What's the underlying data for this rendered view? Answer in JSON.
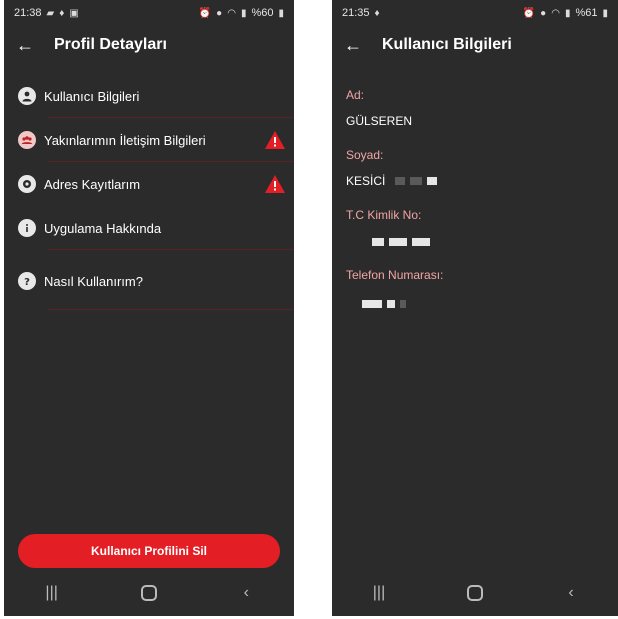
{
  "left_phone": {
    "status_time": "21:38",
    "status_battery": "%60",
    "title": "Profil Detayları",
    "menu": [
      {
        "label": "Kullanıcı Bilgileri",
        "icon": "person-icon",
        "warning": false
      },
      {
        "label": "Yakınlarımın İletişim Bilgileri",
        "icon": "group-icon",
        "warning": true
      },
      {
        "label": "Adres Kayıtlarım",
        "icon": "location-icon",
        "warning": true
      },
      {
        "label": "Uygulama Hakkında",
        "icon": "info-icon",
        "warning": false
      },
      {
        "label": "Nasıl Kullanırım?",
        "icon": "help-icon",
        "warning": false
      }
    ],
    "delete_button": "Kullanıcı Profilini Sil"
  },
  "right_phone": {
    "status_time": "21:35",
    "status_battery": "%61",
    "title": "Kullanıcı Bilgileri",
    "fields": [
      {
        "label": "Ad:",
        "value": "GÜLSEREN"
      },
      {
        "label": "Soyad:",
        "value": "KESİCİ"
      },
      {
        "label": "T.C Kimlik No:",
        "value": ""
      },
      {
        "label": "Telefon Numarası:",
        "value": ""
      }
    ]
  },
  "colors": {
    "background": "#2b2b2b",
    "accent": "#e31e24",
    "label": "#f2a5a5",
    "divider": "#5a2222"
  }
}
